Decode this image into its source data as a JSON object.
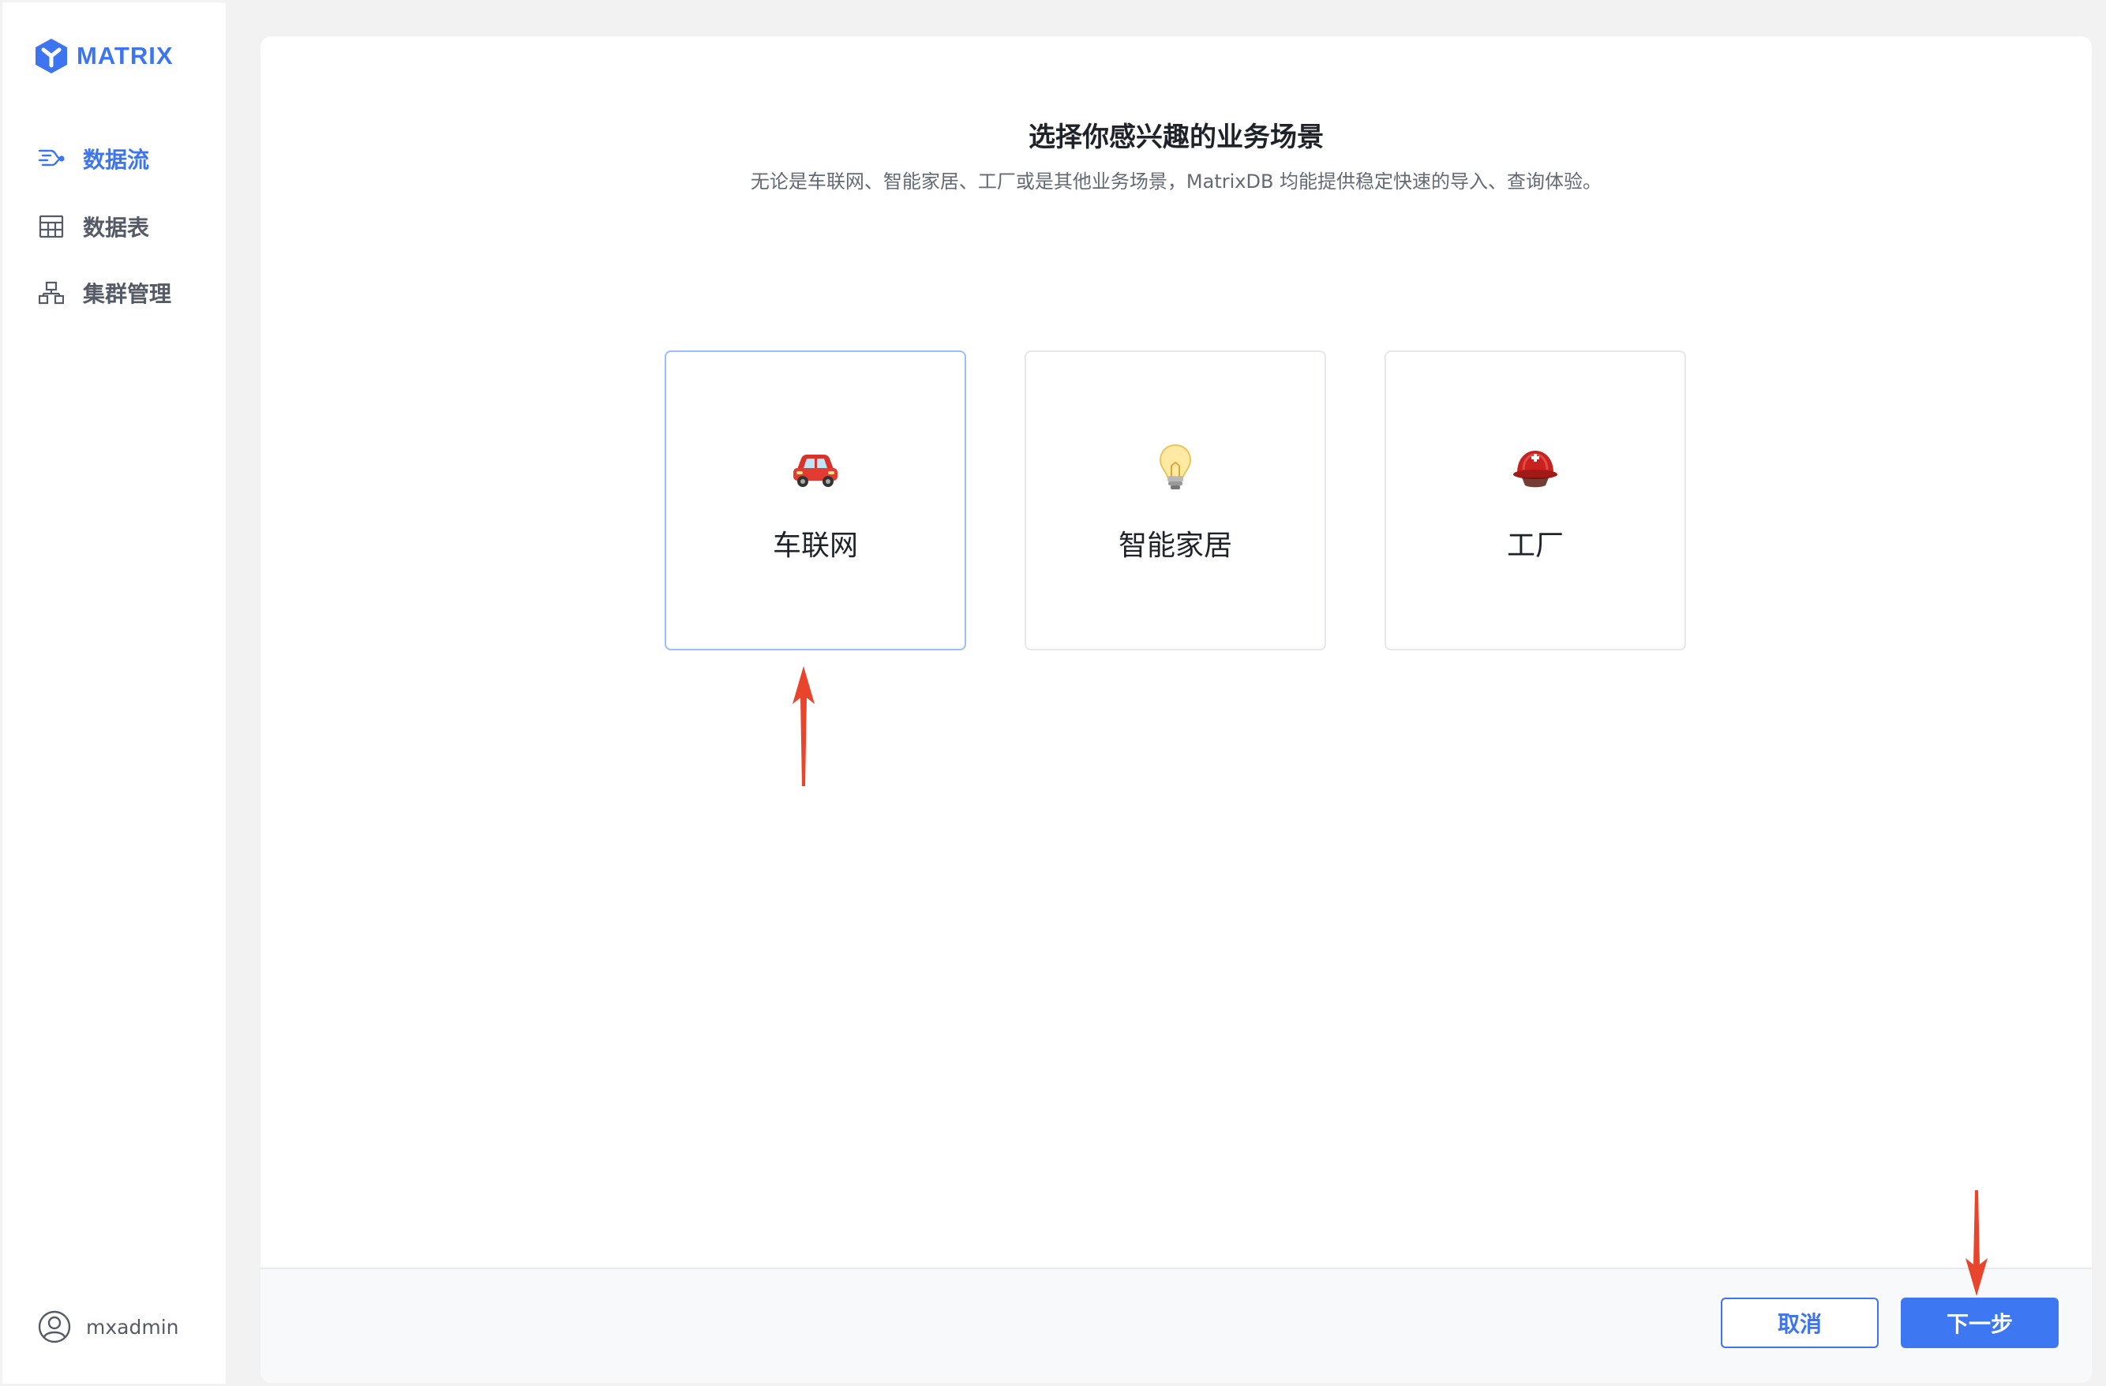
{
  "app": {
    "logo_text": "MATRIX",
    "brand_color": "#3d74f0"
  },
  "sidebar": {
    "items": [
      {
        "label": "数据流",
        "icon": "data-flow-icon",
        "active": true
      },
      {
        "label": "数据表",
        "icon": "table-icon",
        "active": false
      },
      {
        "label": "集群管理",
        "icon": "cluster-icon",
        "active": false
      }
    ],
    "user": {
      "name": "mxadmin",
      "icon": "user-avatar-icon"
    }
  },
  "main": {
    "title": "选择你感兴趣的业务场景",
    "subtitle": "无论是车联网、智能家居、工厂或是其他业务场景，MatrixDB 均能提供稳定快速的导入、查询体验。",
    "scenarios": [
      {
        "label": "车联网",
        "icon": "car-icon",
        "selected": true
      },
      {
        "label": "智能家居",
        "icon": "light-bulb-icon",
        "selected": false
      },
      {
        "label": "工厂",
        "icon": "helmet-icon",
        "selected": false
      }
    ]
  },
  "footer": {
    "cancel_label": "取消",
    "next_label": "下一步"
  },
  "colors": {
    "primary": "#3d78f2",
    "annotation_arrow": "#e8452c"
  }
}
